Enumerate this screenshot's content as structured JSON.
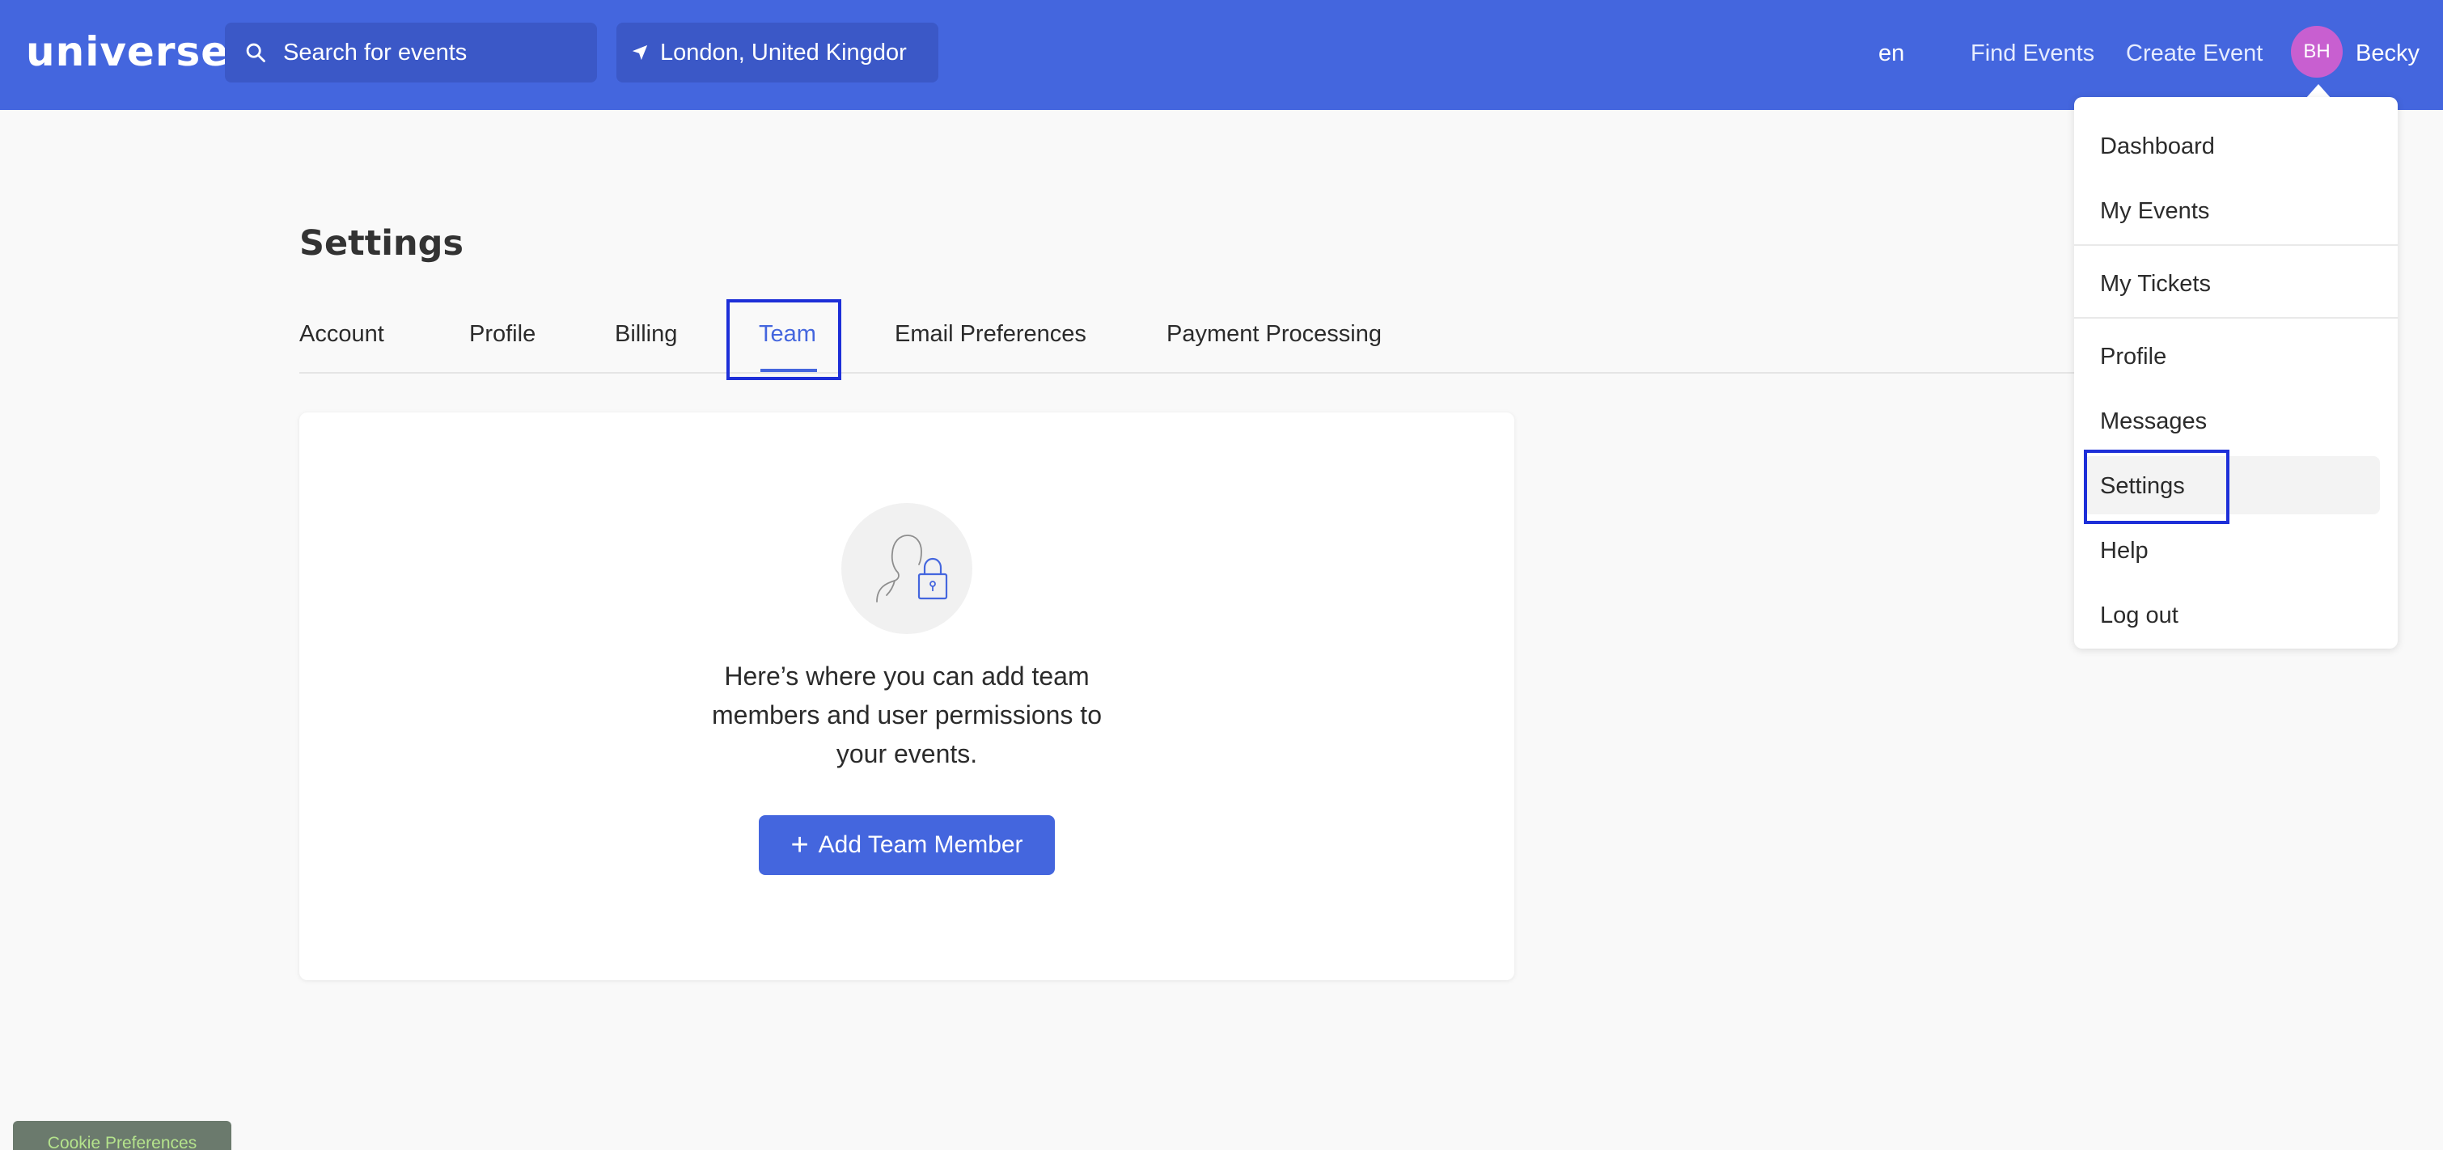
{
  "header": {
    "logo": "universe",
    "search_placeholder": "Search for events",
    "location": "London, United Kingdor",
    "language": "en",
    "find_events": "Find Events",
    "create_event": "Create Event",
    "avatar_initials": "BH",
    "user_name": "Becky"
  },
  "user_menu": {
    "items": [
      {
        "label": "Dashboard"
      },
      {
        "label": "My Events"
      },
      {
        "label": "My Tickets"
      },
      {
        "label": "Profile"
      },
      {
        "label": "Messages"
      },
      {
        "label": "Settings"
      },
      {
        "label": "Help"
      },
      {
        "label": "Log out"
      }
    ]
  },
  "settings": {
    "title": "Settings",
    "tabs": [
      {
        "label": "Account"
      },
      {
        "label": "Profile"
      },
      {
        "label": "Billing"
      },
      {
        "label": "Team"
      },
      {
        "label": "Email Preferences"
      },
      {
        "label": "Payment Processing"
      }
    ],
    "active_tab": "Team"
  },
  "team_card": {
    "message": "Here’s where you can add team members and user permissions to your events.",
    "add_button": "Add Team Member"
  },
  "cookie": {
    "label": "Cookie Preferences"
  },
  "colors": {
    "brand": "#4466de",
    "highlight_box": "#1d2fd8",
    "avatar": "#c85fd0"
  }
}
